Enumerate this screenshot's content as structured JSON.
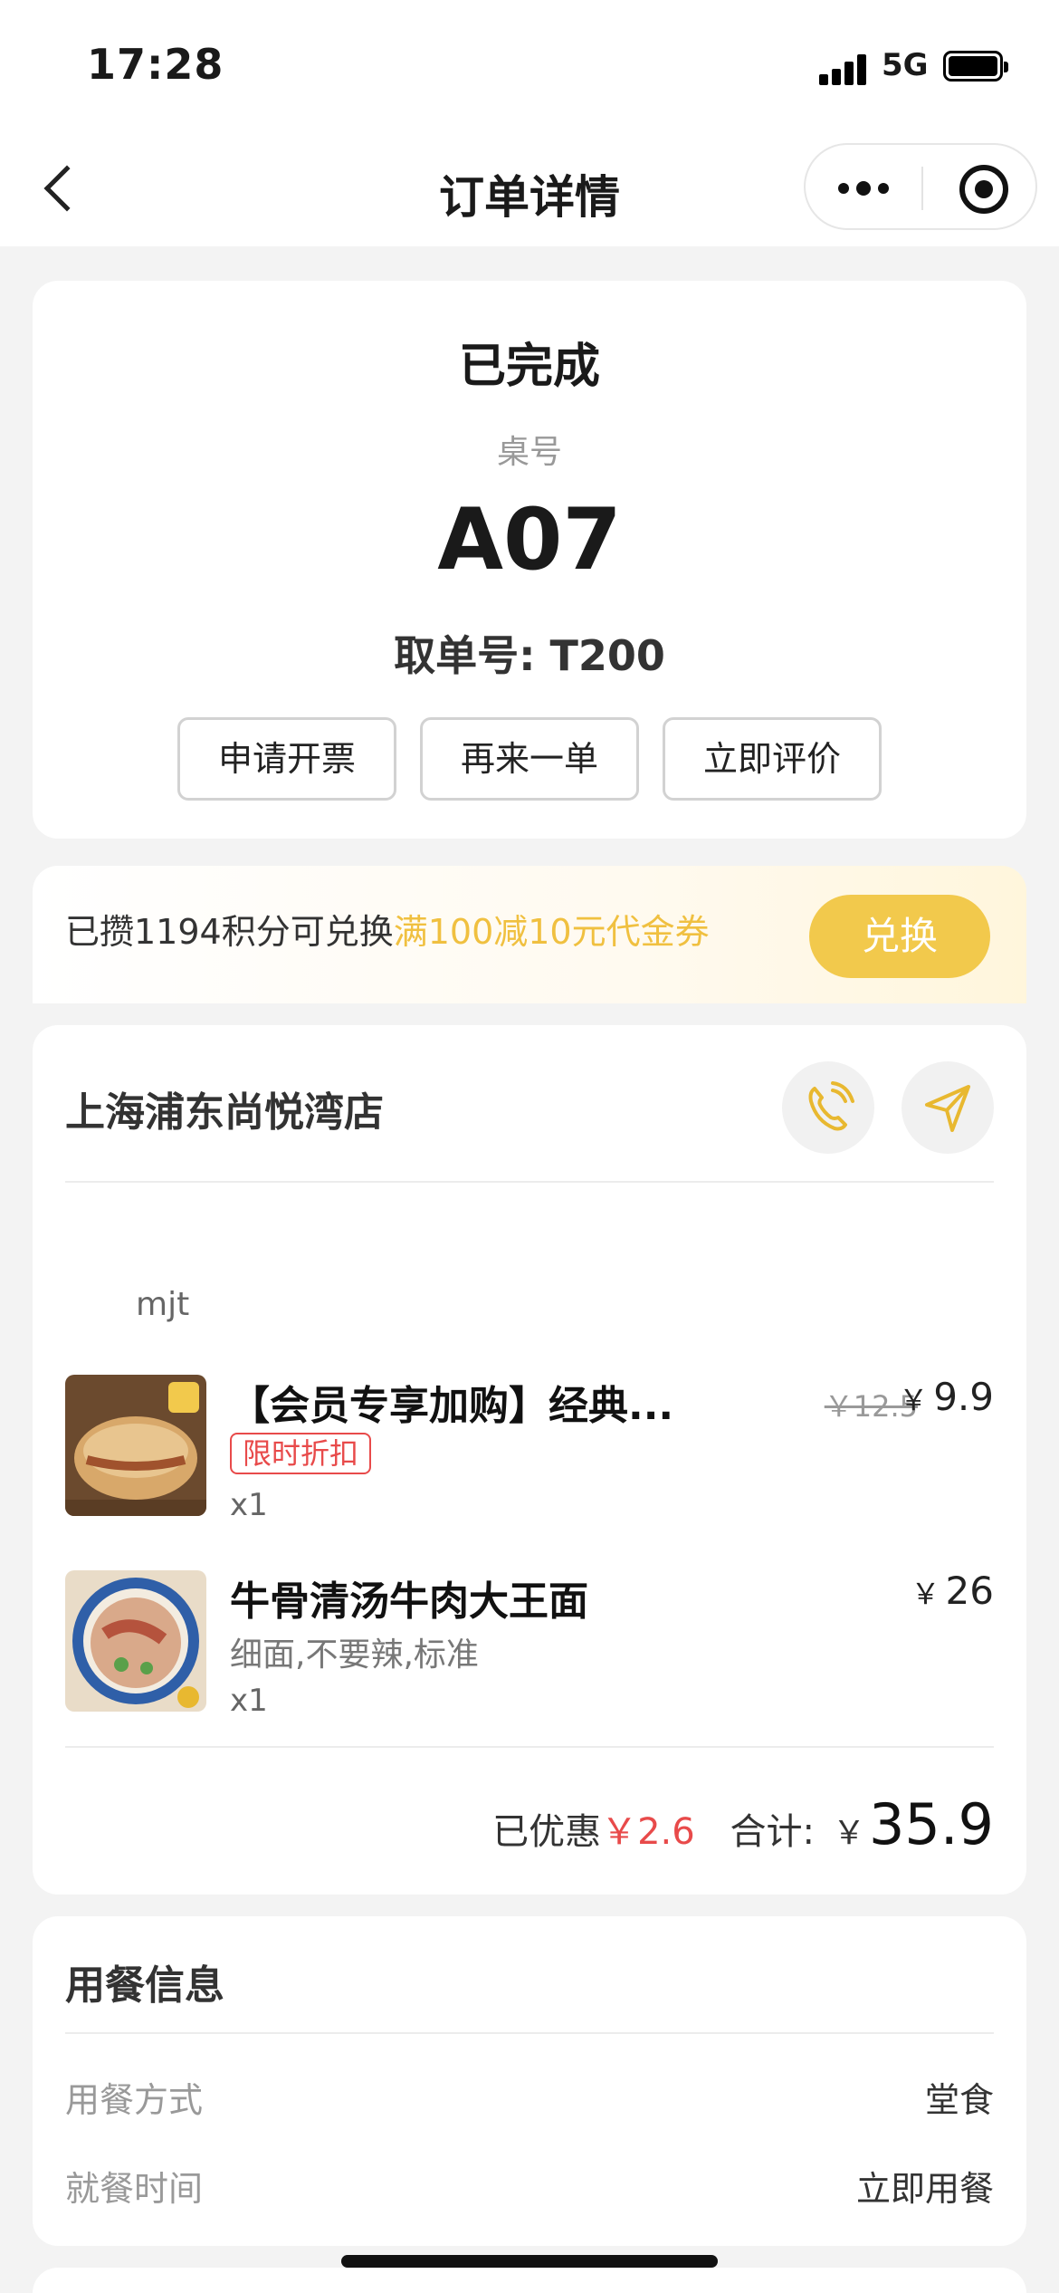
{
  "status_bar": {
    "time": "17:28",
    "network": "5G"
  },
  "nav": {
    "title": "订单详情",
    "back_icon": "chevron-left-icon",
    "more_icon": "more-dots-icon",
    "close_icon": "target-circle-icon"
  },
  "order_status": {
    "status": "已完成",
    "table_label": "桌号",
    "table_number": "A07",
    "pickup_number": "取单号: T200",
    "buttons": [
      "申请开票",
      "再来一单",
      "立即评价"
    ]
  },
  "points": {
    "text": "已攒1194积分可兑换",
    "highlight": "满100减10元代金券",
    "button": "兑换"
  },
  "store": {
    "name": "上海浦东尚悦湾店",
    "phone_icon": "phone-icon",
    "nav_icon": "navigation-arrow-icon"
  },
  "user": "mjt",
  "items": [
    {
      "name": "【会员专享加购】经典...",
      "tag": "限时折扣",
      "qty": "x1",
      "old_price": "￥12.5",
      "price_symbol": "￥",
      "price": "9.9",
      "spec": ""
    },
    {
      "name": "牛骨清汤牛肉大王面",
      "tag": "",
      "qty": "x1",
      "old_price": "",
      "price_symbol": "￥",
      "price": "26",
      "spec": "细面,不要辣,标准"
    }
  ],
  "summary": {
    "discount_label": "已优惠",
    "discount": "￥2.6",
    "total_label": "合计:",
    "total_symbol": "￥",
    "total": "35.9"
  },
  "dining": {
    "title": "用餐信息",
    "rows": [
      {
        "label": "用餐方式",
        "value": "堂食"
      },
      {
        "label": "就餐时间",
        "value": "立即用餐"
      }
    ]
  },
  "colors": {
    "accent": "#f2c94c",
    "discount_red": "#e84a4a",
    "background": "#f3f3f3"
  }
}
